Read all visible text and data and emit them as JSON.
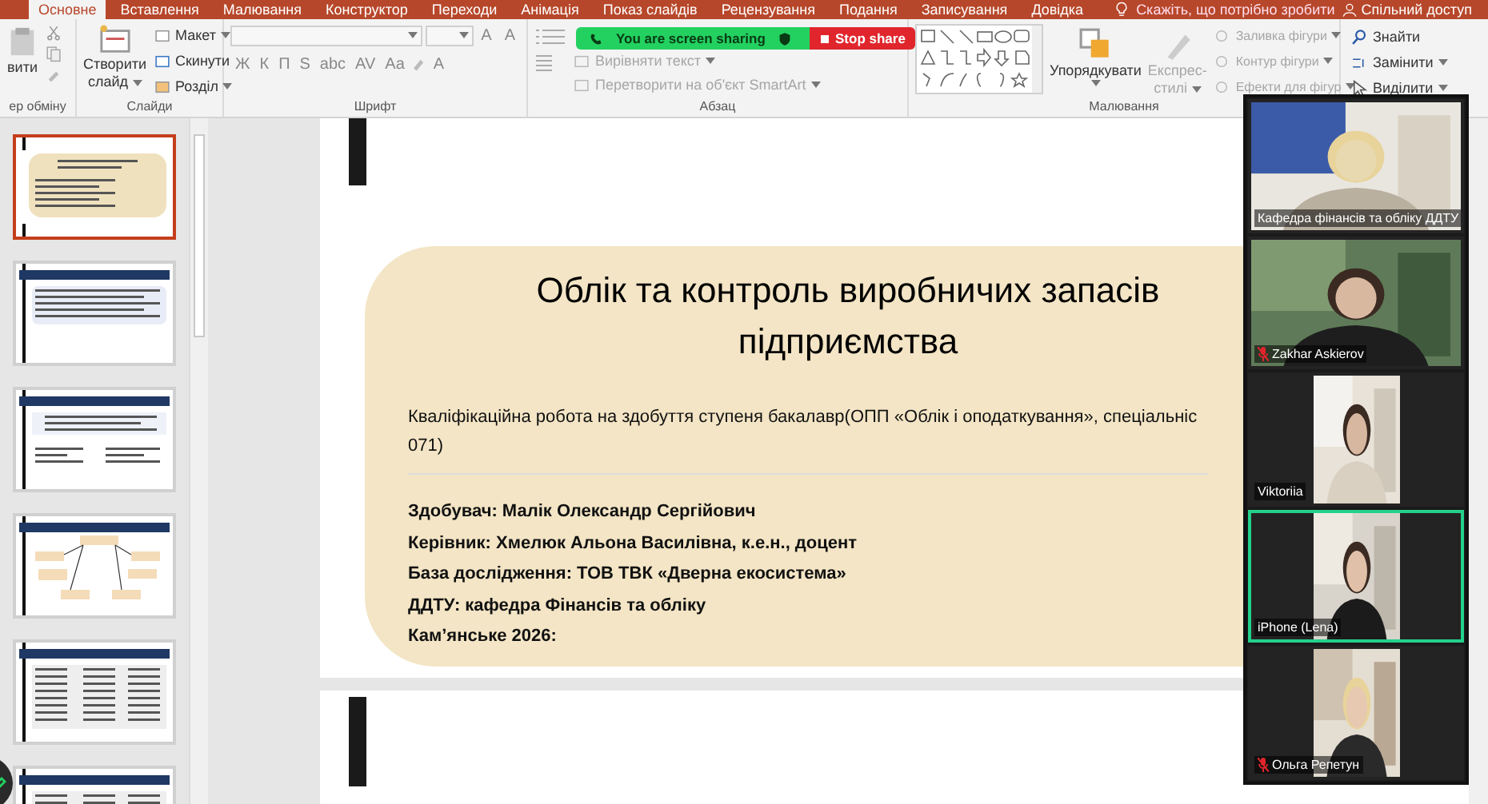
{
  "ribbon_tabs": [
    {
      "label": "Основне",
      "selected": true
    },
    {
      "label": "Вставлення",
      "selected": false
    },
    {
      "label": "Малювання",
      "selected": false
    },
    {
      "label": "Конструктор",
      "selected": false
    },
    {
      "label": "Переходи",
      "selected": false
    },
    {
      "label": "Анімація",
      "selected": false
    },
    {
      "label": "Показ слайдів",
      "selected": false
    },
    {
      "label": "Рецензування",
      "selected": false
    },
    {
      "label": "Подання",
      "selected": false
    },
    {
      "label": "Записування",
      "selected": false
    },
    {
      "label": "Довідка",
      "selected": false
    }
  ],
  "tell_me": "Скажіть, що потрібно зробити",
  "share": "Спільний доступ",
  "ribbon_groups": [
    {
      "kind": "clipboard",
      "label": "ер обміну",
      "paste": "вити"
    },
    {
      "kind": "slides",
      "label": "Слайди",
      "new_slide": [
        "Створити",
        "слайд"
      ],
      "commands": [
        "Макет",
        "Скинути",
        "Розділ"
      ]
    },
    {
      "kind": "font",
      "label": "Шрифт",
      "size_buttons": [
        "A",
        "A"
      ],
      "format_buttons": [
        "Ж",
        "К",
        "П",
        "S",
        "abc",
        "AV",
        "Aa"
      ],
      "color_button": "A"
    },
    {
      "kind": "paragraph",
      "label": "Абзац",
      "commands": [
        {
          "label": "Вирівняти текст",
          "disabled": true
        },
        {
          "label": "Перетворити на об'єкт SmartArt",
          "disabled": true
        }
      ]
    },
    {
      "kind": "drawing",
      "label": "Малювання",
      "arrange": "Упорядкувати",
      "quick_styles": [
        "Експрес-",
        "стилі"
      ],
      "commands": [
        {
          "label": "Заливка фігури",
          "disabled": true
        },
        {
          "label": "Контур фігури",
          "disabled": true
        },
        {
          "label": "Ефекти для фігур",
          "disabled": true
        }
      ]
    },
    {
      "kind": "editing",
      "commands": [
        "Знайти",
        "Замінити",
        "Виділити"
      ]
    }
  ],
  "share_bar": {
    "status": "You are screen sharing",
    "stop": "Stop share"
  },
  "thumbnails": [
    {
      "kind": "title",
      "selected": true
    },
    {
      "kind": "text",
      "selected": false
    },
    {
      "kind": "list",
      "selected": false
    },
    {
      "kind": "diagram",
      "selected": false
    },
    {
      "kind": "table",
      "selected": false
    },
    {
      "kind": "table",
      "selected": false
    }
  ],
  "slide": {
    "title": [
      "Облік та контроль виробничих запасів",
      "підприємства"
    ],
    "subtitle": [
      "Кваліфікаційна робота на здобуття ступеня бакалавр(ОПП «Облік і оподаткування», спеціальніс",
      "071)"
    ],
    "details": [
      "Здобувач: Малік Олександр Сергійович",
      "Керівник: Хмелюк Альона Василівна, к.е.н., доцент",
      "База дослідження: ТОВ ТВК «Дверна екосистема»",
      "ДДТУ: кафедра Фінансів та обліку",
      "Кам’янське 2026:"
    ]
  },
  "video_tiles": [
    {
      "name": "Кафедра фінансів та обліку ДДТУ",
      "kind": "wide",
      "muted": false,
      "active": false
    },
    {
      "name": "Zakhar Askierov",
      "kind": "wide",
      "muted": true,
      "active": false
    },
    {
      "name": "Viktoriia",
      "kind": "portrait",
      "muted": false,
      "active": false
    },
    {
      "name": "iPhone (Lena)",
      "kind": "portrait",
      "muted": false,
      "active": true
    },
    {
      "name": "Ольга Репетун",
      "kind": "portrait",
      "muted": true,
      "active": false
    }
  ]
}
